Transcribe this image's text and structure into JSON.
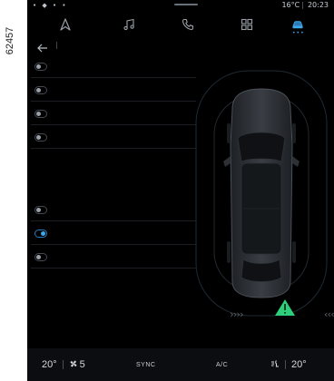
{
  "figure_code": "62457",
  "status_bar": {
    "icons_left": "• ◆ • •",
    "temperature": "16°C",
    "time": "20:23"
  },
  "top_nav": {
    "items": [
      {
        "name": "navigation",
        "icon": "navigation-arrow-icon",
        "active": false
      },
      {
        "name": "music",
        "icon": "music-note-icon",
        "active": false
      },
      {
        "name": "phone",
        "icon": "phone-icon",
        "active": false
      },
      {
        "name": "apps",
        "icon": "apps-grid-icon",
        "active": false
      },
      {
        "name": "vehicle",
        "icon": "car-icon",
        "active": true
      }
    ],
    "active_dots": "•••"
  },
  "back_icon": "back-arrow-icon",
  "settings_list": [
    {
      "state": "off"
    },
    {
      "state": "off"
    },
    {
      "state": "off"
    },
    {
      "state": "off"
    },
    {
      "state": "off"
    },
    {
      "state": "on"
    },
    {
      "state": "off"
    }
  ],
  "parking_view": {
    "left_sensor": "››››",
    "right_sensor": "‹‹‹‹",
    "warning_icon": "warning-triangle-icon",
    "warning_color": "#2ecf7a"
  },
  "climate_bar": {
    "left_temp": "20°",
    "fan_icon": "fan-icon",
    "fan_speed": "5",
    "sync_label": "SYNC",
    "ac_label": "A/C",
    "airflow_icon": "seat-airflow-icon",
    "right_temp": "20°"
  },
  "colors": {
    "background": "#000000",
    "accent": "#3ea9e8",
    "warning": "#2ecf7a",
    "text": "#d5d9de"
  }
}
